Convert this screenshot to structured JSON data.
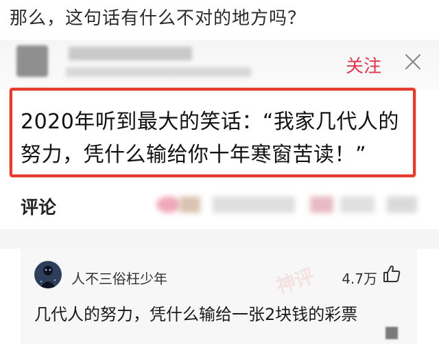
{
  "question": "那么，这句话有什么不对的地方吗？",
  "post": {
    "follow_label": "关注",
    "quote": "2020年听到最大的笑话：“我家几代人的努力，凭什么输给你十年寒窗苦读！”"
  },
  "comments": {
    "label": "评论",
    "top_comment": {
      "username": "人不三俗枉少年",
      "likes": "4.7万",
      "text": "几代人的努力，凭什么输给一张2块钱的彩票",
      "badge": "神评"
    }
  },
  "colors": {
    "accent_red": "#e0384e",
    "highlight_border": "#e53b2c"
  }
}
